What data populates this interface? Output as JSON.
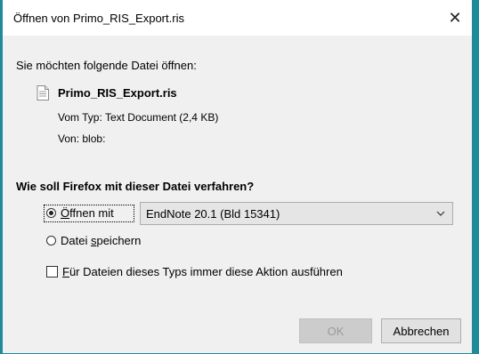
{
  "dialog": {
    "title": "Öffnen von Primo_RIS_Export.ris",
    "close_glyph": "✕",
    "prompt": "Sie möchten folgende Datei öffnen:",
    "file": {
      "icon": "document-icon",
      "name": "Primo_RIS_Export.ris",
      "type_label": "Vom Typ:",
      "type_value": "Text Document (2,4 KB)",
      "from_label": "Von:",
      "from_value": "blob:"
    },
    "question": "Wie soll Firefox mit dieser Datei verfahren?",
    "options": {
      "open_with": {
        "accel": "Ö",
        "rest": "ffnen mit",
        "selected": true
      },
      "app_select": {
        "value": "EndNote 20.1 (Bld 15341)"
      },
      "save_file": {
        "pre": "Datei ",
        "accel": "s",
        "rest": "peichern",
        "selected": false
      }
    },
    "always_checkbox": {
      "accel": "F",
      "rest": "ür Dateien dieses Typs immer diese Aktion ausführen",
      "checked": false
    },
    "buttons": {
      "ok": "OK",
      "cancel": "Abbrechen"
    }
  },
  "colors": {
    "desktop": "#1e8a9a",
    "dialog_bg": "#f0f0f0",
    "titlebar": "#ffffff"
  }
}
